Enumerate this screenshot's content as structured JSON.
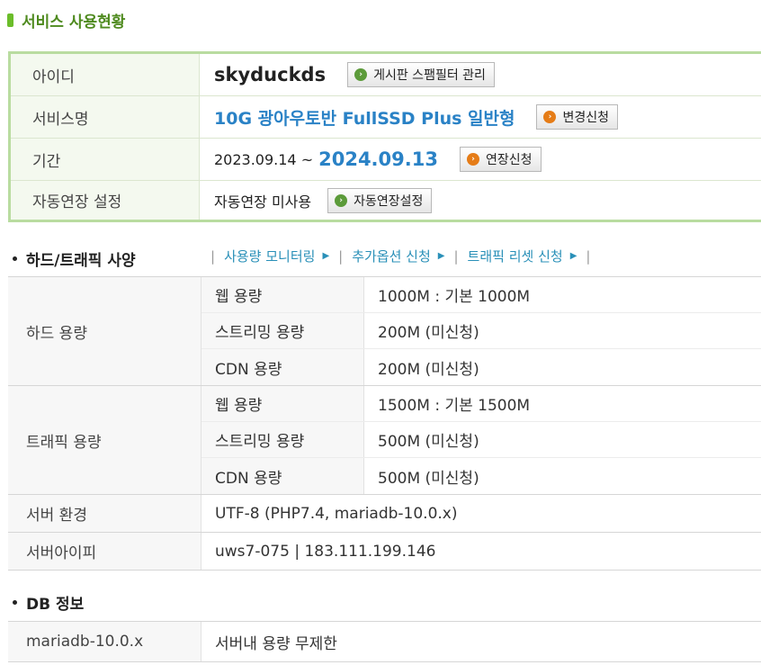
{
  "title": "서비스 사용현황",
  "service": {
    "rows": [
      {
        "label": "아이디"
      },
      {
        "label": "서비스명"
      },
      {
        "label": "기간"
      },
      {
        "label": "자동연장 설정"
      }
    ],
    "user_id": "skyduckds",
    "spam_btn": "게시판 스팸필터 관리",
    "service_name": "10G 광아우토반 FullSSD Plus 일반형",
    "change_btn": "변경신청",
    "period_start": "2023.09.14 ~",
    "period_end": "2024.09.13",
    "extend_btn": "연장신청",
    "auto_renew_status": "자동연장 미사용",
    "auto_renew_btn": "자동연장설정"
  },
  "spec": {
    "heading": "하드/트래픽 사양",
    "links": [
      "사용량 모니터링",
      "추가옵션 신청",
      "트래픽 리셋 신청"
    ],
    "hard": {
      "label": "하드 용량",
      "rows": [
        {
          "name": "웹 용량",
          "value": "1000M : 기본 1000M"
        },
        {
          "name": "스트리밍 용량",
          "value": "200M (미신청)"
        },
        {
          "name": "CDN 용량",
          "value": "200M (미신청)"
        }
      ]
    },
    "traffic": {
      "label": "트래픽 용량",
      "rows": [
        {
          "name": "웹 용량",
          "value": "1500M : 기본 1500M"
        },
        {
          "name": "스트리밍 용량",
          "value": "500M (미신청)"
        },
        {
          "name": "CDN 용량",
          "value": "500M (미신청)"
        }
      ]
    },
    "server_env": {
      "label": "서버 환경",
      "value": "UTF-8 (PHP7.4, mariadb-10.0.x)"
    },
    "server_ip": {
      "label": "서버아이피",
      "value": "uws7-075 | 183.111.199.146"
    }
  },
  "db": {
    "heading": "DB 정보",
    "name": "mariadb-10.0.x",
    "value": "서버내 용량 무제한"
  },
  "colors": {
    "accent_green": "#4e8a1e",
    "link_blue": "#2a82c6",
    "border_green": "#b9dca0"
  }
}
